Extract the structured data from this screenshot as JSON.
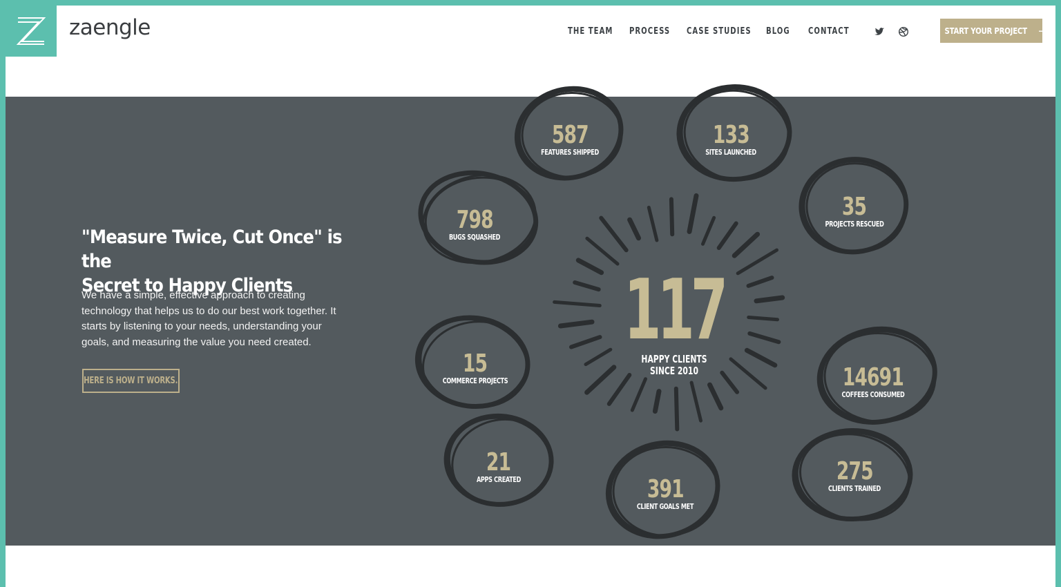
{
  "brand": {
    "name": "zaengle",
    "logo_letter": "Z",
    "accent": "#5cbfae",
    "gold": "#bdb08b",
    "dark": "#535a5e"
  },
  "nav": {
    "items": [
      "THE TEAM",
      "PROCESS",
      "CASE STUDIES",
      "BLOG",
      "CONTACT"
    ],
    "social": [
      "twitter-icon",
      "dribbble-icon"
    ],
    "cta_label": "START YOUR PROJECT",
    "cta_arrow": "→"
  },
  "hero": {
    "headline_line1": "\"Measure Twice, Cut Once\" is the",
    "headline_line2": "Secret to Happy Clients",
    "body": "We have a simple, effective approach to creating technology that helps us to do our best work together. It starts by listening to your needs, understanding your goals, and measuring the value you need created.",
    "button_label": "HERE IS HOW IT WORKS."
  },
  "center_stat": {
    "number": "117",
    "label_line1": "HAPPY CLIENTS",
    "label_line2": "SINCE 2010"
  },
  "stats": [
    {
      "number": "587",
      "label": "FEATURES SHIPPED"
    },
    {
      "number": "133",
      "label": "SITES LAUNCHED"
    },
    {
      "number": "798",
      "label": "BUGS SQUASHED"
    },
    {
      "number": "35",
      "label": "PROJECTS RESCUED"
    },
    {
      "number": "15",
      "label": "COMMERCE PROJECTS"
    },
    {
      "number": "14691",
      "label": "COFFEES CONSUMED"
    },
    {
      "number": "21",
      "label": "APPS CREATED"
    },
    {
      "number": "391",
      "label": "CLIENT GOALS MET"
    },
    {
      "number": "275",
      "label": "CLIENTS TRAINED"
    }
  ]
}
